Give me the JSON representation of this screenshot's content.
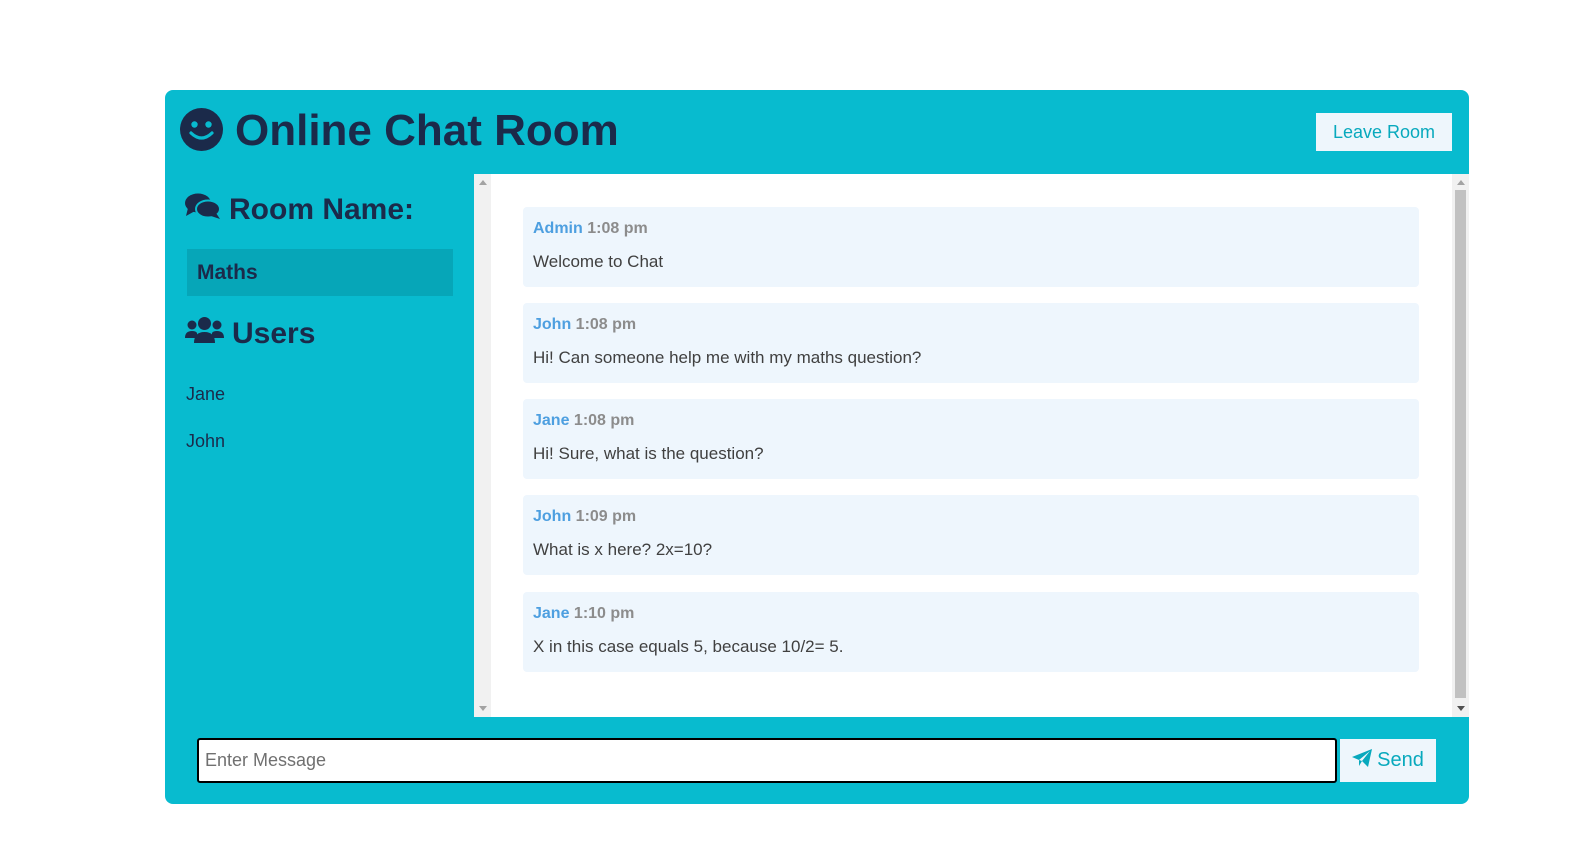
{
  "header": {
    "title": "Online Chat Room",
    "leave_label": "Leave Room",
    "logo_icon": "smiley-icon"
  },
  "sidebar": {
    "room_heading": "Room Name:",
    "room_icon": "comments-icon",
    "room_name": "Maths",
    "users_heading": "Users",
    "users_icon": "users-icon",
    "users": [
      "Jane",
      "John"
    ]
  },
  "messages": [
    {
      "user": "Admin",
      "time": "1:08 pm",
      "text": "Welcome to Chat"
    },
    {
      "user": "John",
      "time": "1:08 pm",
      "text": "Hi! Can someone help me with my maths question?"
    },
    {
      "user": "Jane",
      "time": "1:08 pm",
      "text": "Hi! Sure, what is the question?"
    },
    {
      "user": "John",
      "time": "1:09 pm",
      "text": "What is x here? 2x=10?"
    },
    {
      "user": "Jane",
      "time": "1:10 pm",
      "text": "X in this case equals 5, because 10/2= 5."
    }
  ],
  "form": {
    "placeholder": "Enter Message",
    "value": "",
    "send_label": "Send",
    "send_icon": "paper-plane-icon"
  },
  "colors": {
    "primary": "#08bbcf",
    "dark_text": "#1b2a4a",
    "message_bg": "#eef6fd",
    "username": "#4d9fe0",
    "timestamp": "#8c8c8c"
  }
}
